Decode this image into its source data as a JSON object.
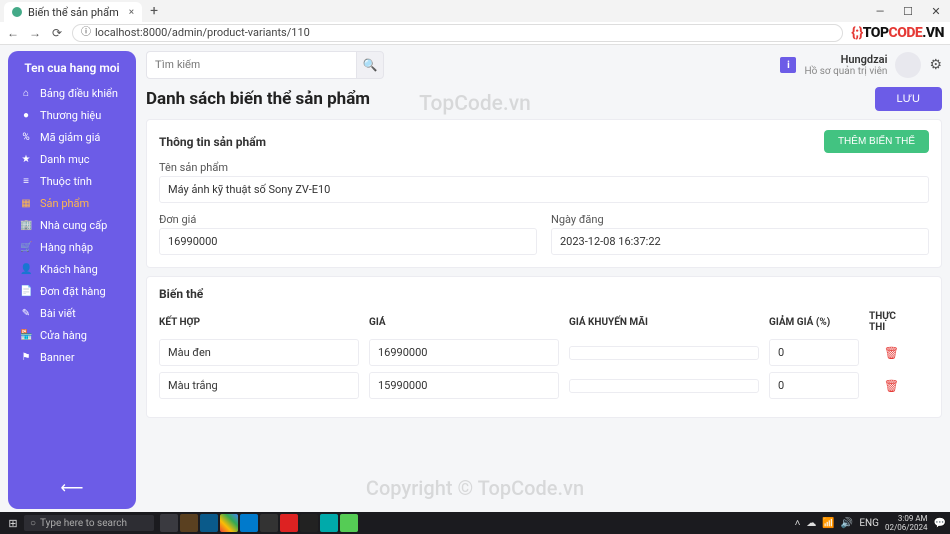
{
  "browser": {
    "tab_title": "Biến thể sản phẩm",
    "url": "localhost:8000/admin/product-variants/110"
  },
  "brand_logo": {
    "pre": "{;}",
    "left": "TOP",
    "right": "CODE",
    "suffix": ".VN"
  },
  "sidebar": {
    "shop_name": "Ten cua hang moi",
    "items": [
      {
        "icon": "⌂",
        "label": "Bảng điều khiển"
      },
      {
        "icon": "●",
        "label": "Thương hiệu"
      },
      {
        "icon": "%",
        "label": "Mã giảm giá"
      },
      {
        "icon": "★",
        "label": "Danh mục"
      },
      {
        "icon": "≡",
        "label": "Thuộc tính"
      },
      {
        "icon": "▦",
        "label": "Sản phẩm",
        "active": true
      },
      {
        "icon": "🏢",
        "label": "Nhà cung cấp"
      },
      {
        "icon": "🛒",
        "label": "Hàng nhập"
      },
      {
        "icon": "👤",
        "label": "Khách hàng"
      },
      {
        "icon": "📄",
        "label": "Đơn đặt hàng"
      },
      {
        "icon": "✎",
        "label": "Bài viết"
      },
      {
        "icon": "🏪",
        "label": "Cửa hàng"
      },
      {
        "icon": "⚑",
        "label": "Banner"
      }
    ]
  },
  "search": {
    "placeholder": "Tìm kiếm"
  },
  "user": {
    "name": "Hungdzai",
    "role": "Hồ sơ quản trị viên",
    "badge": "i"
  },
  "page": {
    "title": "Danh sách biến thể sản phẩm",
    "save_label": "LƯU"
  },
  "product_info": {
    "section_title": "Thông tin sản phẩm",
    "add_variant_label": "THÊM BIẾN THỂ",
    "name_label": "Tên sản phẩm",
    "name_value": "Máy ảnh kỹ thuật số Sony ZV-E10",
    "price_label": "Đơn giá",
    "price_value": "16990000",
    "date_label": "Ngày đăng",
    "date_value": "2023-12-08 16:37:22"
  },
  "variant_section": {
    "title": "Biến thể",
    "columns": {
      "combo": "KẾT HỢP",
      "price": "GIÁ",
      "promo": "GIÁ KHUYẾN MÃI",
      "discount": "GIẢM GIÁ (%)",
      "action": "THỰC THI"
    },
    "rows": [
      {
        "combo": "Màu đen",
        "price": "16990000",
        "promo": "",
        "discount": "0"
      },
      {
        "combo": "Màu trắng",
        "price": "15990000",
        "promo": "",
        "discount": "0"
      }
    ]
  },
  "watermark": {
    "top": "TopCode.vn",
    "bottom": "Copyright © TopCode.vn"
  },
  "taskbar": {
    "search_placeholder": "Type here to search",
    "time": "3:09 AM",
    "date": "02/06/2024"
  }
}
